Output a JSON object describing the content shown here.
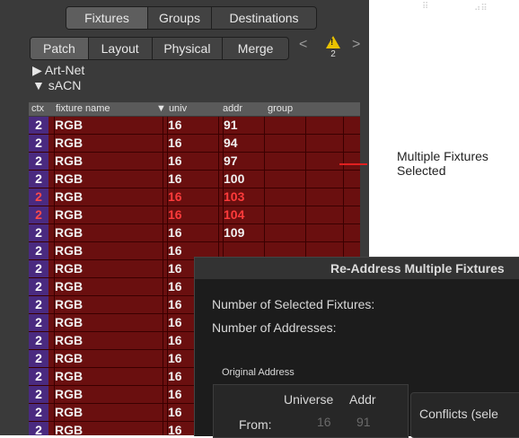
{
  "top_tabs": [
    {
      "label": "Fixtures",
      "active": true
    },
    {
      "label": "Groups",
      "active": false
    },
    {
      "label": "Destinations",
      "active": false
    }
  ],
  "sub_tabs": [
    {
      "label": "Patch",
      "active": true
    },
    {
      "label": "Layout",
      "active": false
    },
    {
      "label": "Physical",
      "active": false
    },
    {
      "label": "Merge",
      "active": false
    }
  ],
  "nav": {
    "prev": "<",
    "next": ">"
  },
  "warning": {
    "icon": "warning-icon",
    "symbol": "!",
    "count": "2"
  },
  "tree": {
    "artnet": {
      "arrow": "▶",
      "label": "Art-Net"
    },
    "sacn": {
      "arrow": "▼",
      "label": "sACN"
    }
  },
  "columns": {
    "ctx": "ctx",
    "fixture_name": "fixture name",
    "univ": "▼ univ",
    "addr": "addr",
    "group": "group"
  },
  "rows": [
    {
      "ctx": "2",
      "name": "RGB",
      "univ": "16",
      "addr": "91",
      "conflict": false
    },
    {
      "ctx": "2",
      "name": "RGB",
      "univ": "16",
      "addr": "94",
      "conflict": false
    },
    {
      "ctx": "2",
      "name": "RGB",
      "univ": "16",
      "addr": "97",
      "conflict": false
    },
    {
      "ctx": "2",
      "name": "RGB",
      "univ": "16",
      "addr": "100",
      "conflict": false
    },
    {
      "ctx": "2",
      "name": "RGB",
      "univ": "16",
      "addr": "103",
      "conflict": true
    },
    {
      "ctx": "2",
      "name": "RGB",
      "univ": "16",
      "addr": "104",
      "conflict": true
    },
    {
      "ctx": "2",
      "name": "RGB",
      "univ": "16",
      "addr": "109",
      "conflict": false
    },
    {
      "ctx": "2",
      "name": "RGB",
      "univ": "16",
      "addr": "",
      "conflict": false
    },
    {
      "ctx": "2",
      "name": "RGB",
      "univ": "16",
      "addr": "",
      "conflict": false
    },
    {
      "ctx": "2",
      "name": "RGB",
      "univ": "16",
      "addr": "",
      "conflict": false
    },
    {
      "ctx": "2",
      "name": "RGB",
      "univ": "16",
      "addr": "",
      "conflict": false
    },
    {
      "ctx": "2",
      "name": "RGB",
      "univ": "16",
      "addr": "",
      "conflict": false
    },
    {
      "ctx": "2",
      "name": "RGB",
      "univ": "16",
      "addr": "",
      "conflict": false
    },
    {
      "ctx": "2",
      "name": "RGB",
      "univ": "16",
      "addr": "",
      "conflict": false
    },
    {
      "ctx": "2",
      "name": "RGB",
      "univ": "16",
      "addr": "",
      "conflict": false
    },
    {
      "ctx": "2",
      "name": "RGB",
      "univ": "16",
      "addr": "",
      "conflict": false
    },
    {
      "ctx": "2",
      "name": "RGB",
      "univ": "16",
      "addr": "",
      "conflict": false
    },
    {
      "ctx": "2",
      "name": "RGB",
      "univ": "16",
      "addr": "",
      "conflict": false
    }
  ],
  "callout": {
    "line1": "Multiple Fixtures",
    "line2": "Selected",
    "line_color": "#e02020"
  },
  "dialog": {
    "title": "Re-Address Multiple Fixtures",
    "selected_label": "Number of Selected Fixtures:",
    "addresses_label": "Number of Addresses:",
    "original_address": "Original Address",
    "universe_header": "Universe",
    "addr_header": "Addr",
    "from_label": "From:",
    "from_universe": "16",
    "from_addr": "91",
    "conflicts_label": "Conflicts (sele"
  },
  "colors": {
    "row_bg": "#6a0f0f",
    "ctx_bg": "#4a2a80",
    "conflict_text": "#ff3b3b",
    "warning": "#e9c200"
  }
}
